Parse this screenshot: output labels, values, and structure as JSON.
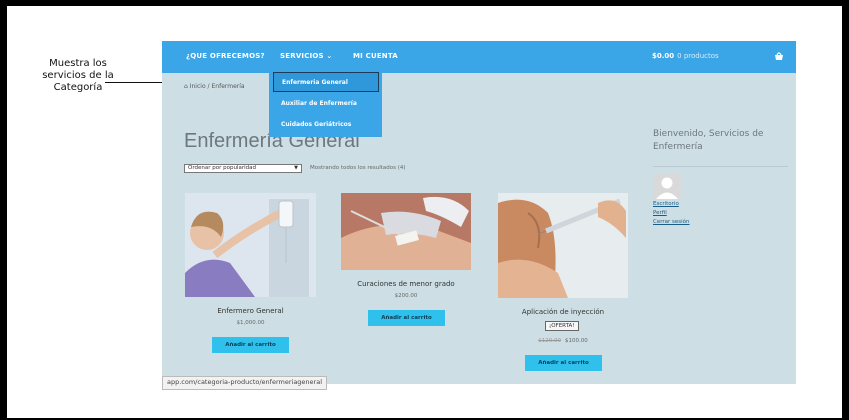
{
  "annotation": {
    "line1": "Muestra los",
    "line2": "servicios de la",
    "line3": "Categoría"
  },
  "nav": {
    "items": [
      "¿QUE OFRECEMOS?",
      "SERVICIOS ⌄",
      "MI CUENTA"
    ],
    "cart_total": "$0.00",
    "cart_count": "0 productos",
    "cart_icon": "basket-icon"
  },
  "breadcrumb": {
    "home": "Inicio",
    "sep": "/",
    "current": "Enfermería"
  },
  "dropdown": [
    "Enfermeria General",
    "Auxiliar de Enfermería",
    "Cuidados Geriátricos"
  ],
  "page_title": "Enfermería General",
  "sort": {
    "selected": "Ordenar por popularidad",
    "result_count": "Mostrando todos los resultados (4)"
  },
  "products": [
    {
      "name": "Enfermero General",
      "price": "$1,000.00",
      "button": "Añadir al carrito"
    },
    {
      "name": "Curaciones de menor grado",
      "price": "$200.00",
      "button": "Añadir al carrito"
    },
    {
      "name": "Aplicación de inyección",
      "badge": "¡OFERTA!",
      "old_price": "$120.00",
      "price": "$100.00",
      "button": "Añadir al carrito"
    }
  ],
  "sidebar": {
    "welcome": "Bienvenido, Servicios de Enfermería",
    "links": [
      "Escritorio",
      "Perfil",
      "Cerrar sesión"
    ]
  },
  "status_url": "app.com/categoria-producto/enfermeriageneral",
  "colors": {
    "nav": "#3aa6e8",
    "page_bg": "#cddfe4",
    "button": "#2fc1ec"
  }
}
